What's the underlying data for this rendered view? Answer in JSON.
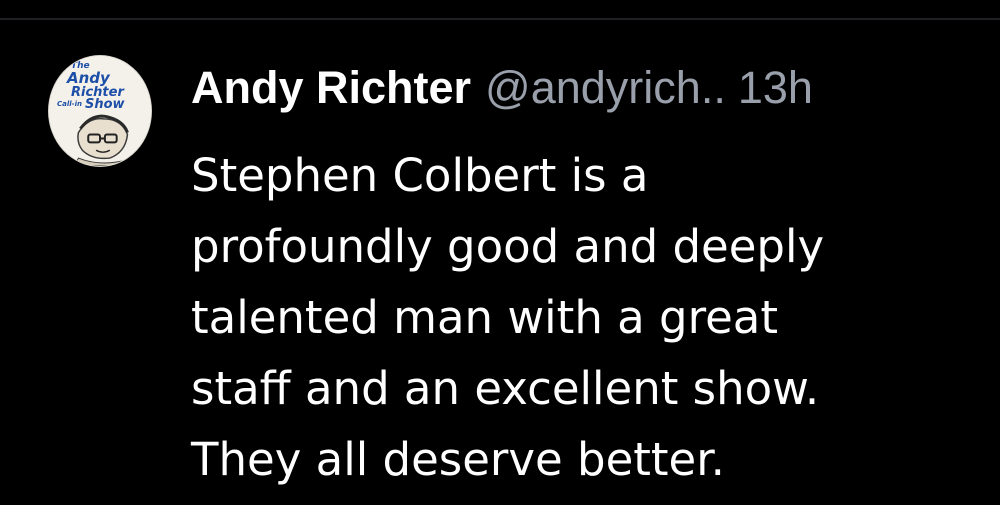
{
  "tweet": {
    "author": {
      "display_name": "Andy Richter",
      "handle": "@andyrich..",
      "avatar_logo": {
        "line1": "The",
        "line2": "Andy",
        "line3": "Richter",
        "line4": "Call-in",
        "line5": "Show"
      }
    },
    "timestamp": "13h",
    "text_lines": [
      "Stephen Colbert is a",
      "profoundly good and deeply",
      "talented man with a great",
      "staff and an excellent show.",
      "They all deserve better."
    ]
  },
  "colors": {
    "background": "#000000",
    "primary_text": "#ffffff",
    "secondary_text": "#9aa0ab",
    "logo_blue": "#1e4fa8"
  },
  "icons": [
    "avatar-logo-image"
  ]
}
